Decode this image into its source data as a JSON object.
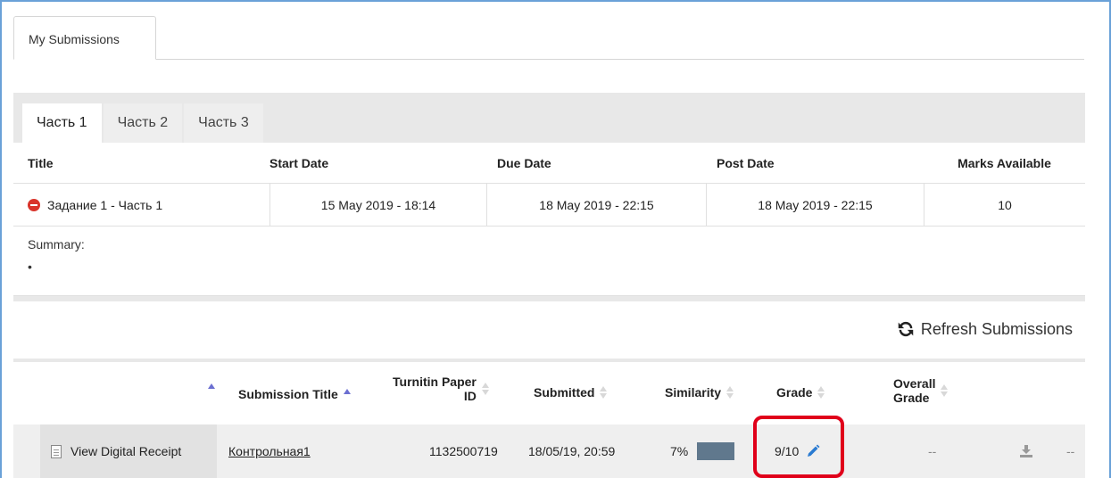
{
  "top_tab": {
    "label": "My Submissions"
  },
  "part_tabs": [
    {
      "label": "Часть 1",
      "active": true
    },
    {
      "label": "Часть 2",
      "active": false
    },
    {
      "label": "Часть 3",
      "active": false
    }
  ],
  "assignment": {
    "headers": {
      "title": "Title",
      "start": "Start Date",
      "due": "Due Date",
      "post": "Post Date",
      "marks": "Marks Available"
    },
    "row": {
      "title": "Задание 1 - Часть 1",
      "start": "15 May 2019 - 18:14",
      "due": "18 May 2019 - 22:15",
      "post": "18 May 2019 - 22:15",
      "marks": "10"
    },
    "summary_label": "Summary:",
    "summary_bullet": "•"
  },
  "refresh": {
    "label": "Refresh Submissions"
  },
  "submissions": {
    "headers": {
      "title": "Submission Title",
      "paper_id_line1": "Turnitin Paper",
      "paper_id_line2": "ID",
      "submitted": "Submitted",
      "similarity": "Similarity",
      "grade": "Grade",
      "overall_line1": "Overall",
      "overall_line2": "Grade"
    },
    "row": {
      "receipt": "View Digital Receipt",
      "title": "Контрольная1",
      "paper_id": "1132500719",
      "submitted": "18/05/19, 20:59",
      "similarity": "7%",
      "grade": "9/10",
      "overall": "--",
      "last": "--"
    }
  },
  "colors": {
    "accent_border": "#6aa1d8",
    "highlight": "#e0001a",
    "similarity_bar": "#60788d",
    "pencil": "#2a7bd1",
    "status_red": "#d9342b"
  }
}
